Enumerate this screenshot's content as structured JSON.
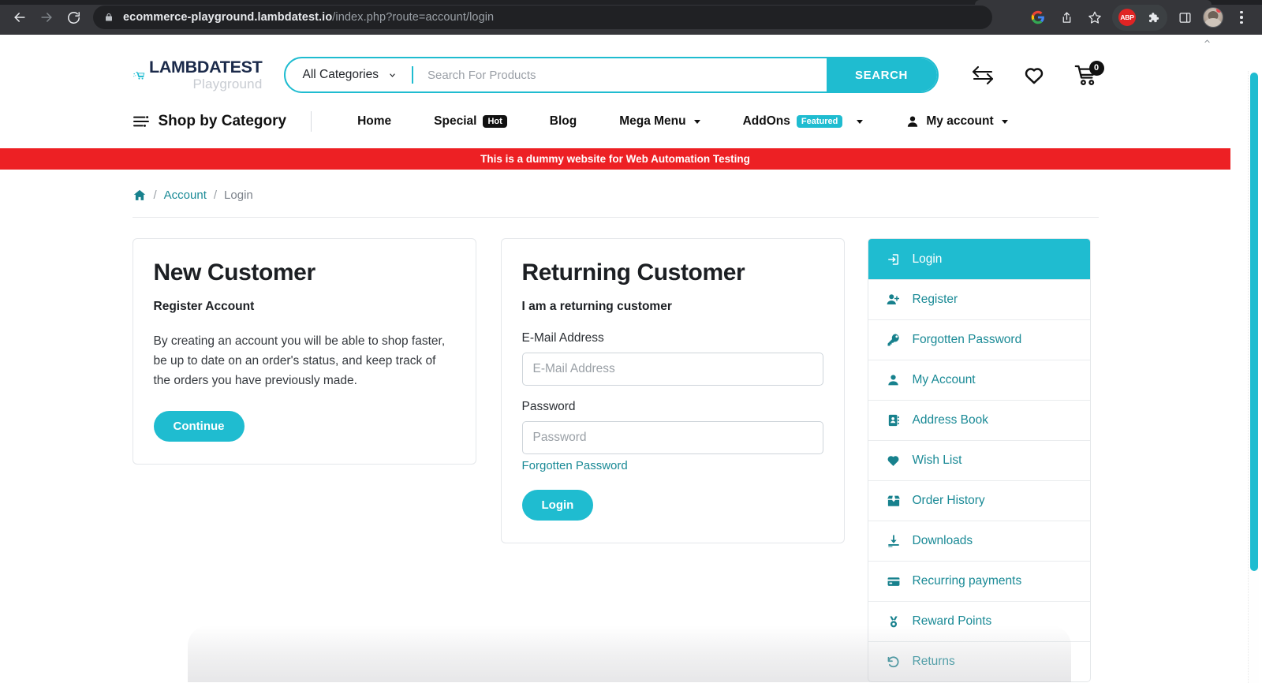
{
  "browser": {
    "url_bold": "ecommerce-playground.lambdatest.io",
    "url_rest": "/index.php?route=account/login",
    "back_title": "Back",
    "forward_title": "Forward",
    "reload_title": "Reload",
    "icons": {
      "lock": "lock-icon",
      "google": "google-icon",
      "share": "share-icon",
      "bookmark": "star-icon",
      "adblock": "ABP",
      "extensions": "puzzle-icon",
      "sidepanel": "side-panel-icon",
      "profile": "avatar",
      "menu": "three-dots-menu"
    }
  },
  "header": {
    "logo_main": "LAMBDATEST",
    "logo_sub": "Playground",
    "category_select": "All Categories",
    "search_placeholder": "Search For Products",
    "search_value": "",
    "search_button": "SEARCH",
    "cart_count": "0"
  },
  "nav": {
    "shop_by_category": "Shop by Category",
    "links": [
      {
        "label": "Home",
        "badge": null,
        "caret": false
      },
      {
        "label": "Special",
        "badge": "Hot",
        "caret": false
      },
      {
        "label": "Blog",
        "badge": null,
        "caret": false
      },
      {
        "label": "Mega Menu",
        "badge": null,
        "caret": true
      },
      {
        "label": "AddOns",
        "badge": "Featured",
        "caret": true
      },
      {
        "label": "My account",
        "badge": null,
        "caret": true
      }
    ]
  },
  "banner": {
    "text": "This is a dummy website for Web Automation Testing"
  },
  "breadcrumb": {
    "home": "home-icon",
    "sep": "/",
    "account": "Account",
    "current": "Login"
  },
  "new_customer": {
    "title": "New Customer",
    "subtitle": "Register Account",
    "body": "By creating an account you will be able to shop faster, be up to date on an order's status, and keep track of the orders you have previously made.",
    "button": "Continue"
  },
  "returning_customer": {
    "title": "Returning Customer",
    "subtitle": "I am a returning customer",
    "email_label": "E-Mail Address",
    "email_placeholder": "E-Mail Address",
    "email_value": "",
    "password_label": "Password",
    "password_placeholder": "Password",
    "password_value": "",
    "forgot_link": "Forgotten Password",
    "button": "Login"
  },
  "account_sidebar": {
    "items": [
      {
        "label": "Login",
        "icon": "login-arrow-icon",
        "active": true
      },
      {
        "label": "Register",
        "icon": "user-plus-icon",
        "active": false
      },
      {
        "label": "Forgotten Password",
        "icon": "key-icon",
        "active": false
      },
      {
        "label": "My Account",
        "icon": "user-icon",
        "active": false
      },
      {
        "label": "Address Book",
        "icon": "address-book-icon",
        "active": false
      },
      {
        "label": "Wish List",
        "icon": "heart-icon",
        "active": false
      },
      {
        "label": "Order History",
        "icon": "open-box-icon",
        "active": false
      },
      {
        "label": "Downloads",
        "icon": "download-icon",
        "active": false
      },
      {
        "label": "Recurring payments",
        "icon": "credit-card-icon",
        "active": false
      },
      {
        "label": "Reward Points",
        "icon": "medal-icon",
        "active": false
      },
      {
        "label": "Returns",
        "icon": "undo-arrow-icon",
        "active": false
      }
    ]
  },
  "colors": {
    "accent_teal": "#1fbcd0",
    "link_teal": "#1a8a96",
    "banner_red": "#ed2024",
    "badge_hot": "#111111",
    "logo_navy": "#1b2a4a"
  }
}
